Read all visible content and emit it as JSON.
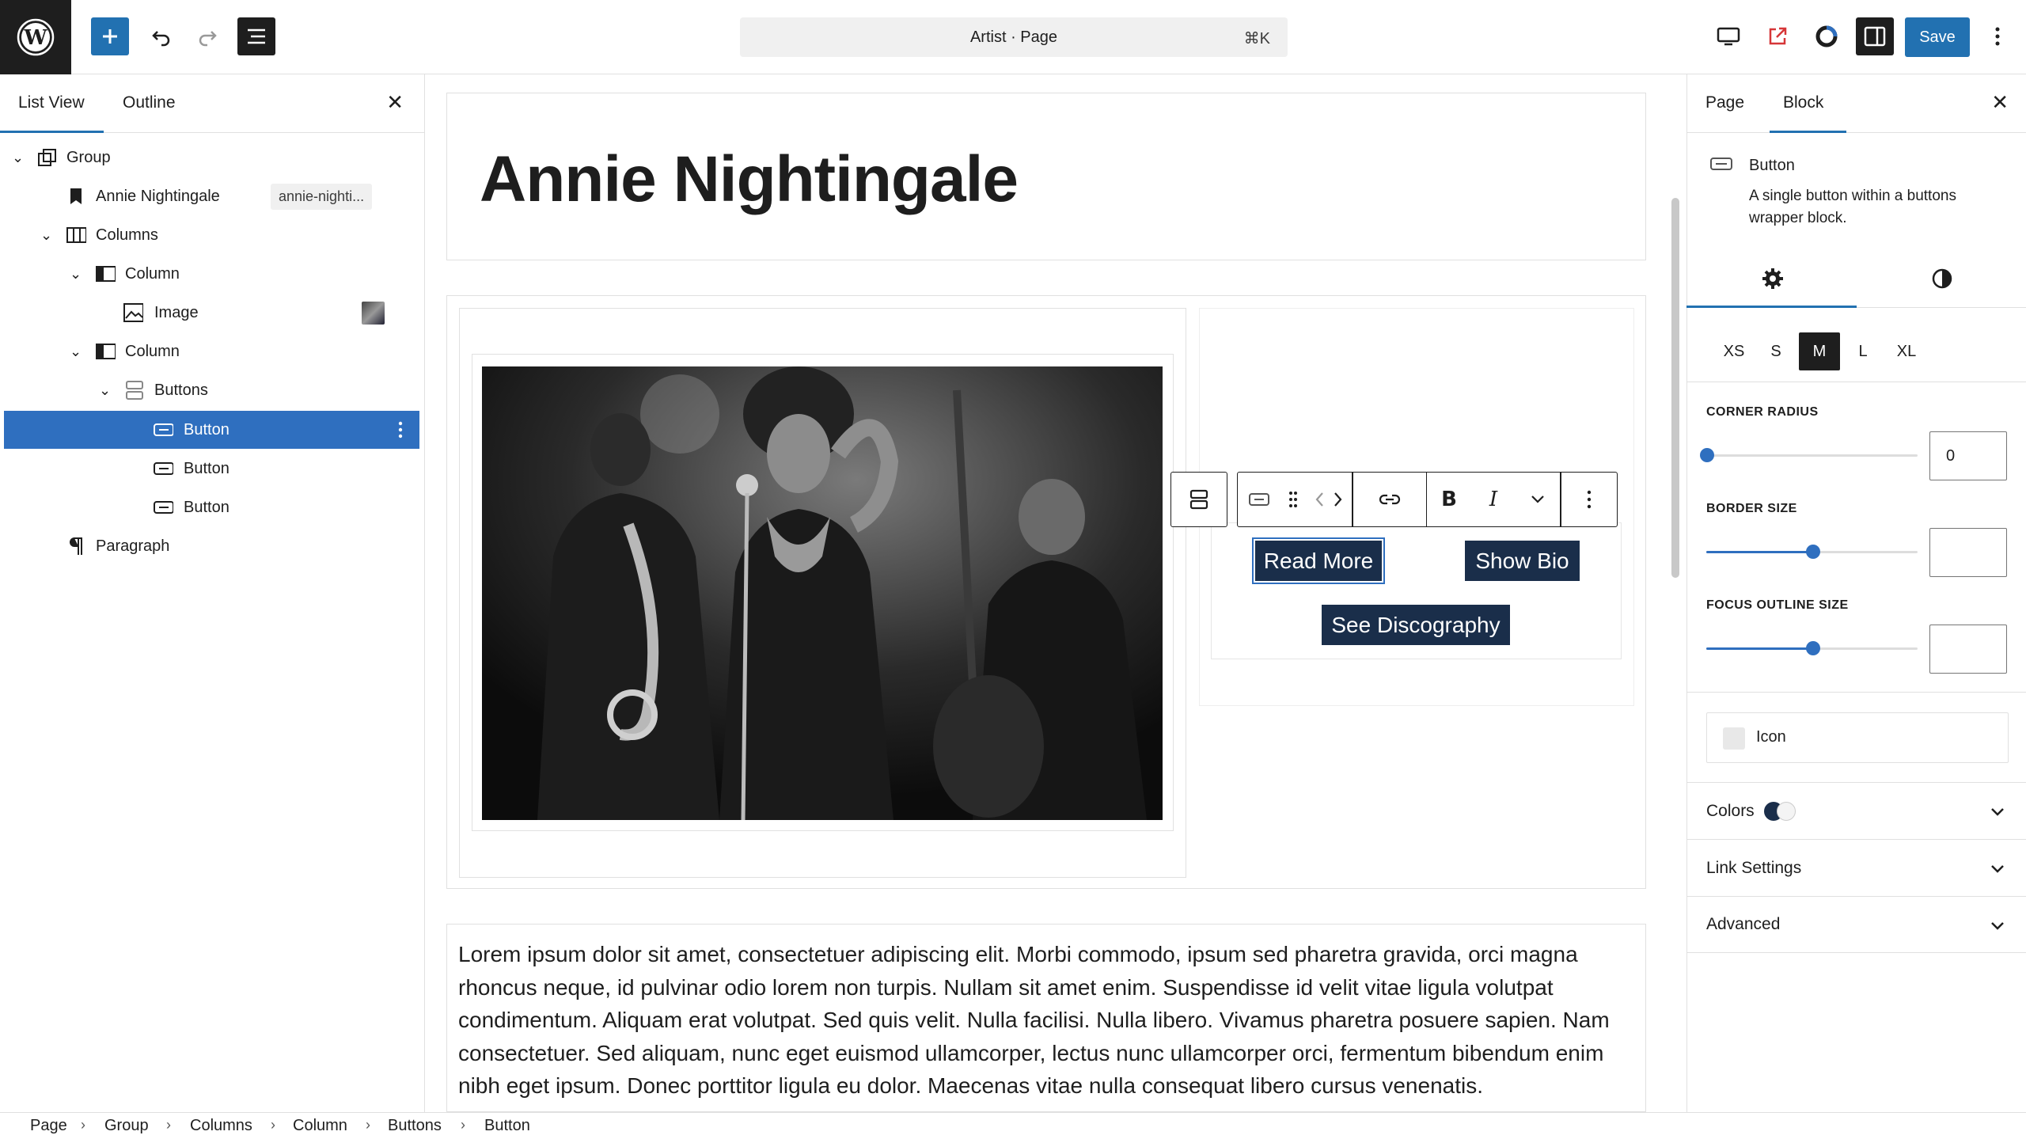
{
  "header": {
    "document_title": "Artist · Page",
    "shortcut": "⌘K",
    "save_label": "Save"
  },
  "left_panel": {
    "tabs": [
      "List View",
      "Outline"
    ],
    "active_tab": "List View",
    "tree": [
      {
        "label": "Group",
        "icon": "group-icon",
        "depth": 0,
        "expanded": true
      },
      {
        "label": "Annie Nightingale",
        "icon": "bookmark-icon",
        "depth": 1,
        "badge": "annie-nighti..."
      },
      {
        "label": "Columns",
        "icon": "columns-icon",
        "depth": 1,
        "expanded": true
      },
      {
        "label": "Column",
        "icon": "column-icon",
        "depth": 2,
        "expanded": true
      },
      {
        "label": "Image",
        "icon": "image-icon",
        "depth": 3,
        "thumbnail": true
      },
      {
        "label": "Column",
        "icon": "column-icon",
        "depth": 2,
        "expanded": true
      },
      {
        "label": "Buttons",
        "icon": "buttons-icon",
        "depth": 3,
        "expanded": true
      },
      {
        "label": "Button",
        "icon": "button-icon",
        "depth": 4,
        "selected": true
      },
      {
        "label": "Button",
        "icon": "button-icon",
        "depth": 4
      },
      {
        "label": "Button",
        "icon": "button-icon",
        "depth": 4
      },
      {
        "label": "Paragraph",
        "icon": "paragraph-icon",
        "depth": 1
      }
    ]
  },
  "canvas": {
    "heading": "Annie Nightingale",
    "buttons": [
      "Read More",
      "Show Bio",
      "See Discography"
    ],
    "paragraph": "Lorem ipsum dolor sit amet, consectetuer adipiscing elit. Morbi commodo, ipsum sed pharetra gravida, orci magna rhoncus neque, id pulvinar odio lorem non turpis. Nullam sit amet enim. Suspendisse id velit vitae ligula volutpat condimentum. Aliquam erat volutpat. Sed quis velit. Nulla facilisi. Nulla libero. Vivamus pharetra posuere sapien. Nam consectetuer. Sed aliquam, nunc eget euismod ullamcorper, lectus nunc ullamcorper orci, fermentum bibendum enim nibh eget ipsum. Donec porttitor ligula eu dolor. Maecenas vitae nulla consequat libero cursus venenatis."
  },
  "right_panel": {
    "tabs": [
      "Page",
      "Block"
    ],
    "active_tab": "Block",
    "block_name": "Button",
    "block_desc": "A single button within a buttons wrapper block.",
    "sizes": [
      "XS",
      "S",
      "M",
      "L",
      "XL"
    ],
    "selected_size": "M",
    "corner_radius_label": "CORNER RADIUS",
    "corner_radius_value": "0",
    "border_size_label": "BORDER SIZE",
    "focus_outline_label": "FOCUS OUTLINE SIZE",
    "icon_label": "Icon",
    "colors_label": "Colors",
    "link_settings_label": "Link Settings",
    "advanced_label": "Advanced"
  },
  "breadcrumb": [
    "Page",
    "Group",
    "Columns",
    "Column",
    "Buttons",
    "Button"
  ],
  "colors": {
    "accent": "#2f6fbf",
    "save_button": "#2271b1",
    "button_bg": "#1a2e4a",
    "dark": "#1e1e1e"
  }
}
